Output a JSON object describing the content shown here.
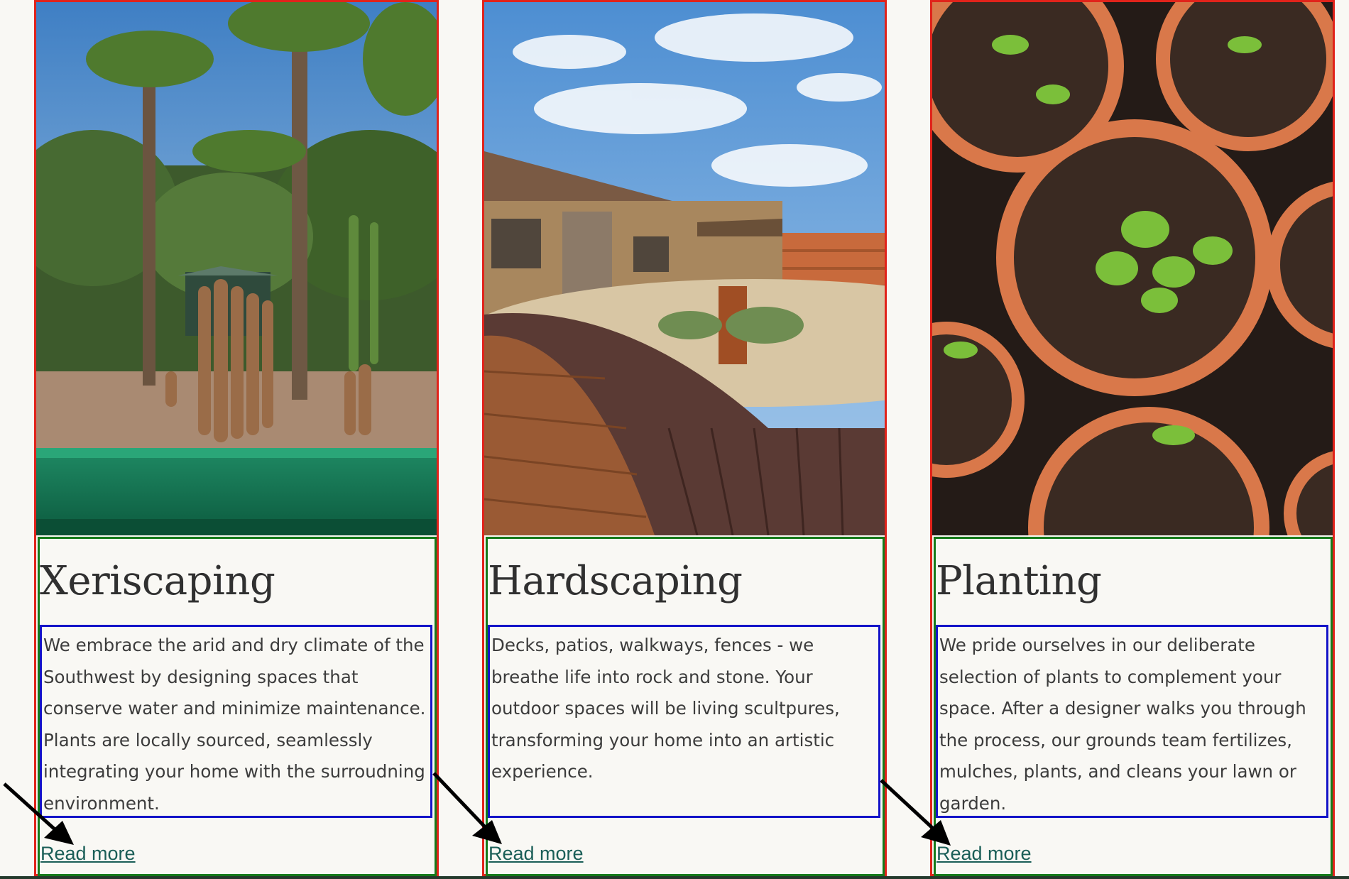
{
  "cards": [
    {
      "title": "Xeriscaping",
      "text": "We embrace the arid and dry climate of the Southwest by designing spaces that conserve water and minimize maintenance. Plants are locally sourced, seamlessly integrating your home with the surroudning environment.",
      "link": "Read more",
      "image": "desert-garden-with-palms-cacti-and-green-tiled-pool"
    },
    {
      "title": "Hardscaping",
      "text": "Decks, patios, walkways, fences - we breathe life into rock and stone. Your outdoor spaces will be living scultpures, transforming your home into an artistic experience.",
      "link": "Read more",
      "image": "curved-wooden-deck-patio-with-gravel-and-agave"
    },
    {
      "title": "Planting",
      "text": "We pride ourselves in our deliberate selection of plants to complement your space. After a designer walks you through the process, our grounds team fertilizes, mulches, plants, and cleans your lawn or garden.",
      "link": "Read more",
      "image": "seedlings-in-terracotta-pots-top-view"
    }
  ],
  "annotations": {
    "arrow_icon": "arrow-pointing-to-read-more",
    "card_outline_color": "#e1231b",
    "body_outline_color": "#157a1a",
    "text_outline_color": "#1414c8",
    "link_color": "#1a5e57"
  }
}
